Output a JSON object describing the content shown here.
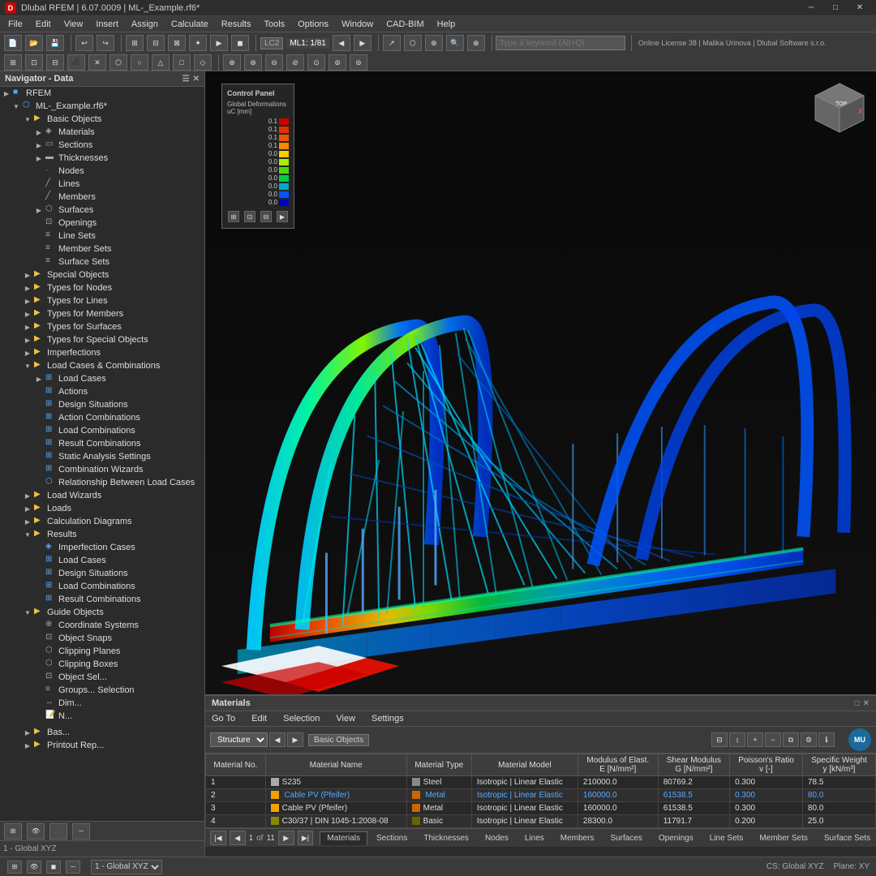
{
  "title_bar": {
    "icon": "D",
    "title": "Dlubal RFEM | 6.07.0009 | ML-_Example.rf6*",
    "minimize": "─",
    "maximize": "□",
    "close": "✕"
  },
  "menu_bar": {
    "items": [
      "File",
      "Edit",
      "View",
      "Insert",
      "Assign",
      "Calculate",
      "Results",
      "Tools",
      "Options",
      "Window",
      "CAD-BIM",
      "Help"
    ]
  },
  "toolbar": {
    "lc_label": "LC2",
    "ml_label": "ML1: 1/81",
    "search_placeholder": "Type a keyword (Alt+Q)",
    "license_text": "Online License 38 | Malika Urinova | Dlubal Software s.r.o."
  },
  "navigator": {
    "title": "Navigator - Data",
    "root": "RFEM",
    "tree": [
      {
        "id": "rfem",
        "label": "RFEM",
        "level": 0,
        "type": "root",
        "expanded": true
      },
      {
        "id": "model",
        "label": "ML-_Example.rf6*",
        "level": 1,
        "type": "model",
        "expanded": true
      },
      {
        "id": "basic",
        "label": "Basic Objects",
        "level": 2,
        "type": "folder",
        "expanded": true
      },
      {
        "id": "materials",
        "label": "Materials",
        "level": 3,
        "type": "item"
      },
      {
        "id": "sections",
        "label": "Sections",
        "level": 3,
        "type": "item"
      },
      {
        "id": "thicknesses",
        "label": "Thicknesses",
        "level": 3,
        "type": "item"
      },
      {
        "id": "nodes",
        "label": "Nodes",
        "level": 3,
        "type": "item"
      },
      {
        "id": "lines",
        "label": "Lines",
        "level": 3,
        "type": "item"
      },
      {
        "id": "members",
        "label": "Members",
        "level": 3,
        "type": "item"
      },
      {
        "id": "surfaces",
        "label": "Surfaces",
        "level": 3,
        "type": "item"
      },
      {
        "id": "openings",
        "label": "Openings",
        "level": 3,
        "type": "item"
      },
      {
        "id": "linesets",
        "label": "Line Sets",
        "level": 3,
        "type": "item"
      },
      {
        "id": "membersets",
        "label": "Member Sets",
        "level": 3,
        "type": "item"
      },
      {
        "id": "surfacesets",
        "label": "Surface Sets",
        "level": 3,
        "type": "item"
      },
      {
        "id": "special",
        "label": "Special Objects",
        "level": 2,
        "type": "folder",
        "expanded": false
      },
      {
        "id": "types_nodes",
        "label": "Types for Nodes",
        "level": 2,
        "type": "folder",
        "expanded": false
      },
      {
        "id": "types_lines",
        "label": "Types for Lines",
        "level": 2,
        "type": "folder",
        "expanded": false
      },
      {
        "id": "types_members",
        "label": "Types for Members",
        "level": 2,
        "type": "folder",
        "expanded": false
      },
      {
        "id": "types_surfaces",
        "label": "Types for Surfaces",
        "level": 2,
        "type": "folder",
        "expanded": false
      },
      {
        "id": "types_special",
        "label": "Types for Special Objects",
        "level": 2,
        "type": "folder",
        "expanded": false
      },
      {
        "id": "imperfections",
        "label": "Imperfections",
        "level": 2,
        "type": "folder",
        "expanded": false
      },
      {
        "id": "load_cases_comb",
        "label": "Load Cases & Combinations",
        "level": 2,
        "type": "folder",
        "expanded": true
      },
      {
        "id": "load_cases",
        "label": "Load Cases",
        "level": 3,
        "type": "item"
      },
      {
        "id": "actions",
        "label": "Actions",
        "level": 3,
        "type": "item"
      },
      {
        "id": "design_situations",
        "label": "Design Situations",
        "level": 3,
        "type": "item"
      },
      {
        "id": "action_combinations",
        "label": "Action Combinations",
        "level": 3,
        "type": "item"
      },
      {
        "id": "load_combinations",
        "label": "Load Combinations",
        "level": 3,
        "type": "item"
      },
      {
        "id": "result_combinations",
        "label": "Result Combinations",
        "level": 3,
        "type": "item"
      },
      {
        "id": "static_analysis",
        "label": "Static Analysis Settings",
        "level": 3,
        "type": "item"
      },
      {
        "id": "combo_wizards",
        "label": "Combination Wizards",
        "level": 3,
        "type": "item"
      },
      {
        "id": "relationship",
        "label": "Relationship Between Load Cases",
        "level": 3,
        "type": "item"
      },
      {
        "id": "load_wizards",
        "label": "Load Wizards",
        "level": 2,
        "type": "folder",
        "expanded": false
      },
      {
        "id": "loads",
        "label": "Loads",
        "level": 2,
        "type": "folder",
        "expanded": false
      },
      {
        "id": "calc_diagrams",
        "label": "Calculation Diagrams",
        "level": 2,
        "type": "folder",
        "expanded": false
      },
      {
        "id": "results",
        "label": "Results",
        "level": 2,
        "type": "folder",
        "expanded": true
      },
      {
        "id": "r_imperfection",
        "label": "Imperfection Cases",
        "level": 3,
        "type": "item"
      },
      {
        "id": "r_load_cases",
        "label": "Load Cases",
        "level": 3,
        "type": "item"
      },
      {
        "id": "r_design_sit",
        "label": "Design Situations",
        "level": 3,
        "type": "item"
      },
      {
        "id": "r_load_comb",
        "label": "Load Combinations",
        "level": 3,
        "type": "item"
      },
      {
        "id": "r_result_comb",
        "label": "Result Combinations",
        "level": 3,
        "type": "item"
      },
      {
        "id": "guide_objects",
        "label": "Guide Objects",
        "level": 2,
        "type": "folder",
        "expanded": true
      },
      {
        "id": "coord_systems",
        "label": "Coordinate Systems",
        "level": 3,
        "type": "item"
      },
      {
        "id": "object_snaps",
        "label": "Object Snaps",
        "level": 3,
        "type": "item"
      },
      {
        "id": "clipping_planes",
        "label": "Clipping Planes",
        "level": 3,
        "type": "item"
      },
      {
        "id": "clipping_boxes",
        "label": "Clipping Boxes",
        "level": 3,
        "type": "item"
      },
      {
        "id": "object_sel",
        "label": "Object Sel...",
        "level": 3,
        "type": "item"
      },
      {
        "id": "groups_sel",
        "label": "Groups... Selection",
        "level": 3,
        "type": "item"
      },
      {
        "id": "dimensions",
        "label": "Dim...",
        "level": 3,
        "type": "item"
      },
      {
        "id": "notes",
        "label": "N...",
        "level": 3,
        "type": "item"
      },
      {
        "id": "printout",
        "label": "Printout Rep...",
        "level": 2,
        "type": "folder"
      }
    ]
  },
  "control_panel": {
    "title": "Control Panel",
    "subtitle": "Global Deformations\nuC [mm]",
    "colorbar": [
      {
        "value": "0.1",
        "color": "#cc0000"
      },
      {
        "value": "0.1",
        "color": "#dd2200"
      },
      {
        "value": "0.1",
        "color": "#ee4400"
      },
      {
        "value": "0.1",
        "color": "#ff8800"
      },
      {
        "value": "0.0",
        "color": "#ffcc00"
      },
      {
        "value": "0.0",
        "color": "#ccee00"
      },
      {
        "value": "0.0",
        "color": "#88dd00"
      },
      {
        "value": "0.0",
        "color": "#00cc44"
      },
      {
        "value": "0.0",
        "color": "#00aacc"
      },
      {
        "value": "0.0",
        "color": "#0055ff"
      },
      {
        "value": "0.0",
        "color": "#0000cc"
      }
    ]
  },
  "materials_panel": {
    "title": "Materials",
    "menu_items": [
      "Go To",
      "Edit",
      "Selection",
      "View",
      "Settings"
    ],
    "structure_label": "Structure",
    "basic_objects_label": "Basic Objects",
    "table": {
      "headers": [
        "Material No.",
        "Material Name",
        "Material Type",
        "Material Model",
        "Modulus of Elast. E [N/mm²]",
        "Shear Modulus G [N/mm²]",
        "Poisson's Ratio v [-]",
        "Specific Weight y [kN/m³]"
      ],
      "rows": [
        {
          "no": "1",
          "name": "S235",
          "color": "#aaaaaa",
          "type": "Steel",
          "type_color": "#888888",
          "model": "Isotropic | Linear Elastic",
          "model_link": false,
          "E": "210000.0",
          "G": "80769.2",
          "v": "0.300",
          "y": "78.5"
        },
        {
          "no": "2",
          "name": "Cable PV (Pfeifer)",
          "name_link": true,
          "color": "#f0a000",
          "type": "Metal",
          "type_link": true,
          "type_color": "#cc6600",
          "model": "Isotropic | Linear Elastic",
          "model_link": true,
          "E": "160000.0",
          "E_link": true,
          "G": "61538.5",
          "G_link": true,
          "v": "0.300",
          "v_link": true,
          "y": "80.0",
          "y_link": true
        },
        {
          "no": "3",
          "name": "Cable PV (Pfeifer)",
          "name_link": false,
          "color": "#f0a000",
          "type": "Metal",
          "type_link": false,
          "type_color": "#cc6600",
          "model": "Isotropic | Linear Elastic",
          "model_link": false,
          "E": "160000.0",
          "G": "61538.5",
          "v": "0.300",
          "y": "80.0"
        },
        {
          "no": "4",
          "name": "C30/37 | DIN 1045-1:2008-08",
          "color": "#888800",
          "type": "Basic",
          "type_color": "#666600",
          "model": "Isotropic | Linear Elastic",
          "model_link": false,
          "E": "28300.0",
          "G": "11791.7",
          "v": "0.200",
          "y": "25.0"
        }
      ]
    },
    "pagination": {
      "current": "1",
      "total": "11"
    },
    "user_avatar": "MU"
  },
  "bottom_tabs": {
    "tabs": [
      "Materials",
      "Sections",
      "Thicknesses",
      "Nodes",
      "Lines",
      "Members",
      "Surfaces",
      "Openings",
      "Line Sets",
      "Member Sets",
      "Surface Sets"
    ],
    "active": "Materials"
  },
  "status_bar": {
    "view_label": "1 - Global XYZ",
    "cs_label": "CS: Global XYZ",
    "plane_label": "Plane: XY"
  }
}
